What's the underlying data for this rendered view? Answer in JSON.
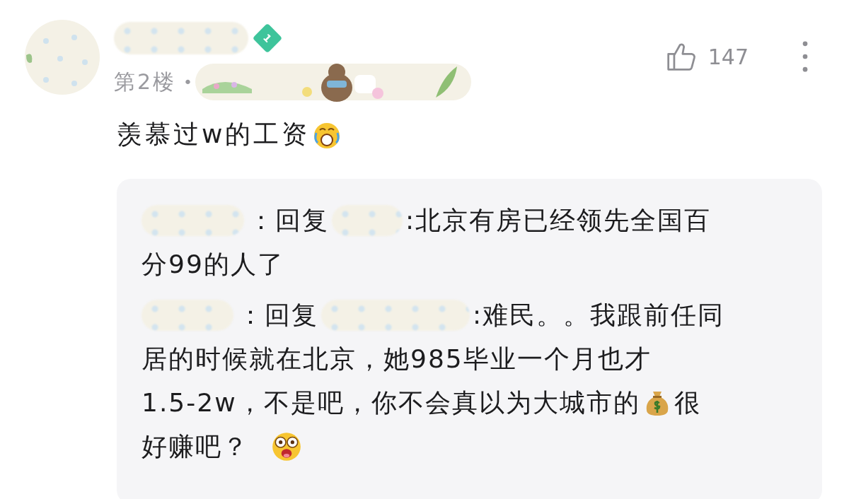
{
  "comment": {
    "level_badge": "1",
    "floor": "第2楼",
    "separator": "•",
    "likes": "147",
    "body": [
      {
        "kind": "text",
        "text": "羡慕过w的工资"
      },
      {
        "kind": "crying"
      }
    ]
  },
  "replies": [
    {
      "lines": [
        [
          {
            "kind": "redacted"
          },
          {
            "kind": "text",
            "text": "："
          },
          {
            "kind": "text",
            "text": "回复"
          },
          {
            "kind": "redacted"
          },
          {
            "kind": "text",
            "text": ":北京有房已经领先全国百"
          }
        ],
        [
          {
            "kind": "text",
            "text": "分99的人了"
          }
        ]
      ]
    },
    {
      "lines": [
        [
          {
            "kind": "redacted"
          },
          {
            "kind": "text",
            "text": "："
          },
          {
            "kind": "text",
            "text": "回复"
          },
          {
            "kind": "redacted"
          },
          {
            "kind": "text",
            "text": ":难民。。我跟前任同"
          }
        ],
        [
          {
            "kind": "text",
            "text": "居的时候就在北京，她985毕业一个月也才"
          }
        ],
        [
          {
            "kind": "text",
            "text": "1.5-2w，不是吧，你不会真以为大城市的"
          },
          {
            "kind": "moneybag"
          },
          {
            "kind": "text",
            "text": "很"
          }
        ],
        [
          {
            "kind": "text",
            "text": "好赚吧？"
          },
          {
            "kind": "dazzled"
          }
        ]
      ]
    }
  ]
}
